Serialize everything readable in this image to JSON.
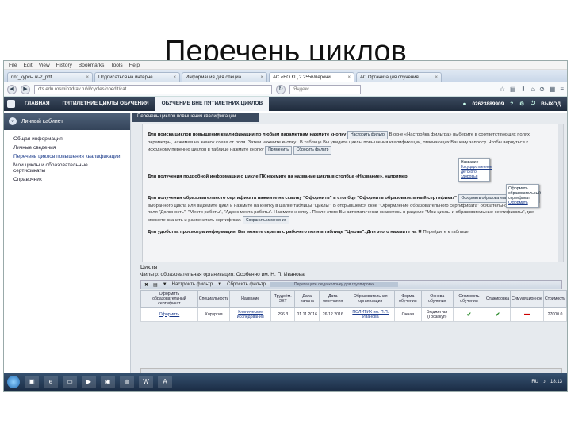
{
  "slide": {
    "title": "Перечень циклов"
  },
  "browser": {
    "menu": [
      "File",
      "Edit",
      "View",
      "History",
      "Bookmarks",
      "Tools",
      "Help"
    ],
    "tabs": [
      {
        "label": "nnr_курсы.ik-2_pdf",
        "active": false
      },
      {
        "label": "Подписаться на интерне...",
        "active": false
      },
      {
        "label": "Информация для специа...",
        "active": false
      },
      {
        "label": "АС «ЕО КЦ 2.2556/перечи...",
        "active": true
      },
      {
        "label": "АС Организация обучения",
        "active": false
      }
    ],
    "url": "cts.edu.rosminzdrav.ru/#/cycles/onedit/cat",
    "search_placeholder": "Яндекс"
  },
  "site": {
    "nav": [
      {
        "label": "ГЛАВНАЯ",
        "active": false
      },
      {
        "label": "ПЯТИЛЕТНИЕ ЦИКЛЫ ОБУЧЕНИЯ",
        "active": false
      },
      {
        "label": "ОБУЧЕНИЕ ВНЕ ПЯТИЛЕТНИХ ЦИКЛОВ",
        "active": true
      }
    ],
    "phone": "02623889909",
    "exit": "ВЫХОД"
  },
  "sidebar": {
    "header": "Личный кабинет",
    "items": [
      {
        "label": "Общая информация",
        "active": false
      },
      {
        "label": "Личные сведения",
        "active": false
      },
      {
        "label": "Перечень циклов повышения квалификации",
        "active": true
      },
      {
        "label": "Мои циклы и образовательные сертификаты",
        "active": false
      },
      {
        "label": "Справочник",
        "active": false
      }
    ]
  },
  "content": {
    "header": "Перечень циклов повышения квалификации",
    "paragraphs": [
      {
        "lead": "Для поиска циклов повышения квалификации по любым параметрам нажмите кнопку",
        "text": "В окне «Настройка фильтра» выберите в соответствующих полях параметры, нажимая на значок слева от поля. Затем нажмите кнопку . В таблице Вы увидите циклы повышения квалификации, отвечающих Вашему запросу. Чтобы вернуться к исходному перечню циклов в таблице нажмите кнопку"
      },
      {
        "lead": "Для получения подробной информации о цикле ПК нажмите на название цикла в столбце «Название», например:",
        "text": ""
      },
      {
        "lead": "Для получения образовательного сертификата нажмите на ссылку \"Оформить\" в столбце \"Оформить образовательный сертификат\"",
        "text": "выбранного цикла или выделите цикл и нажмите на кнопку в шапке таблицы \"Циклы\". В открывшемся окне \"Оформление образовательного сертификата\" обязательно заполните поля \"Должность\", \"Место работы\", \"Адрес места работы\". Нажмите кнопку . После этого Вы автоматически окажетесь в разделе \"Мои циклы и образовательные сертификаты\", где сможете скачать и распечатать сертификат."
      },
      {
        "lead": "Для удобства просмотра информации, Вы можете скрыть с рабочего поля в таблице \"Циклы\". Для этого нажмите на",
        "text": "Перейдите к таблице"
      }
    ],
    "buttons": {
      "filter": "Настроить фильтр",
      "apply": "Применить",
      "reset": "Сбросить фильтр",
      "issue": "Оформить образовательный сертификат",
      "save": "Сохранить изменения"
    },
    "popups": {
      "title": "Название",
      "example": "Государственное детского здоровья",
      "issue_col": "Оформить образовательный сертификат",
      "issue_link": "Оформить"
    }
  },
  "cycles": {
    "title": "Циклы",
    "filter_label": "Фильтр:",
    "filter_value": "образовательная организация: Особенно им. Н. П. Иванова",
    "toolbar": {
      "filter": "Настроить фильтр",
      "reset": "Сбросить фильтр",
      "group_hint": "Перетащите сюда колонку для группировки"
    },
    "columns": [
      "Оформить образовательный сертификат",
      "Специальность",
      "Название",
      "Трудоём. ЗЕТ",
      "Дата начала",
      "Дата окончания",
      "Образовательная организация",
      "Форма обучения",
      "Основа обучения",
      "Стоимость обучения",
      "Стажировка",
      "Симуляционное",
      "Стоимость"
    ],
    "rows": [
      {
        "issue": "Оформить",
        "specialty": "Хирургия",
        "name": "Клинические исследования",
        "zet": "296 3",
        "start": "01.11.2016",
        "end": "26.12.2016",
        "org": "ПОЛИТИК им. П.П. Иванова",
        "form": "Очная",
        "basis": "Бюджет-ая (Госзакуп)",
        "cost_flag": "ok",
        "intern": "ok",
        "sim": "minus",
        "price": "27000.0"
      }
    ]
  },
  "taskbar": {
    "lang": "RU",
    "time": "18:13"
  }
}
